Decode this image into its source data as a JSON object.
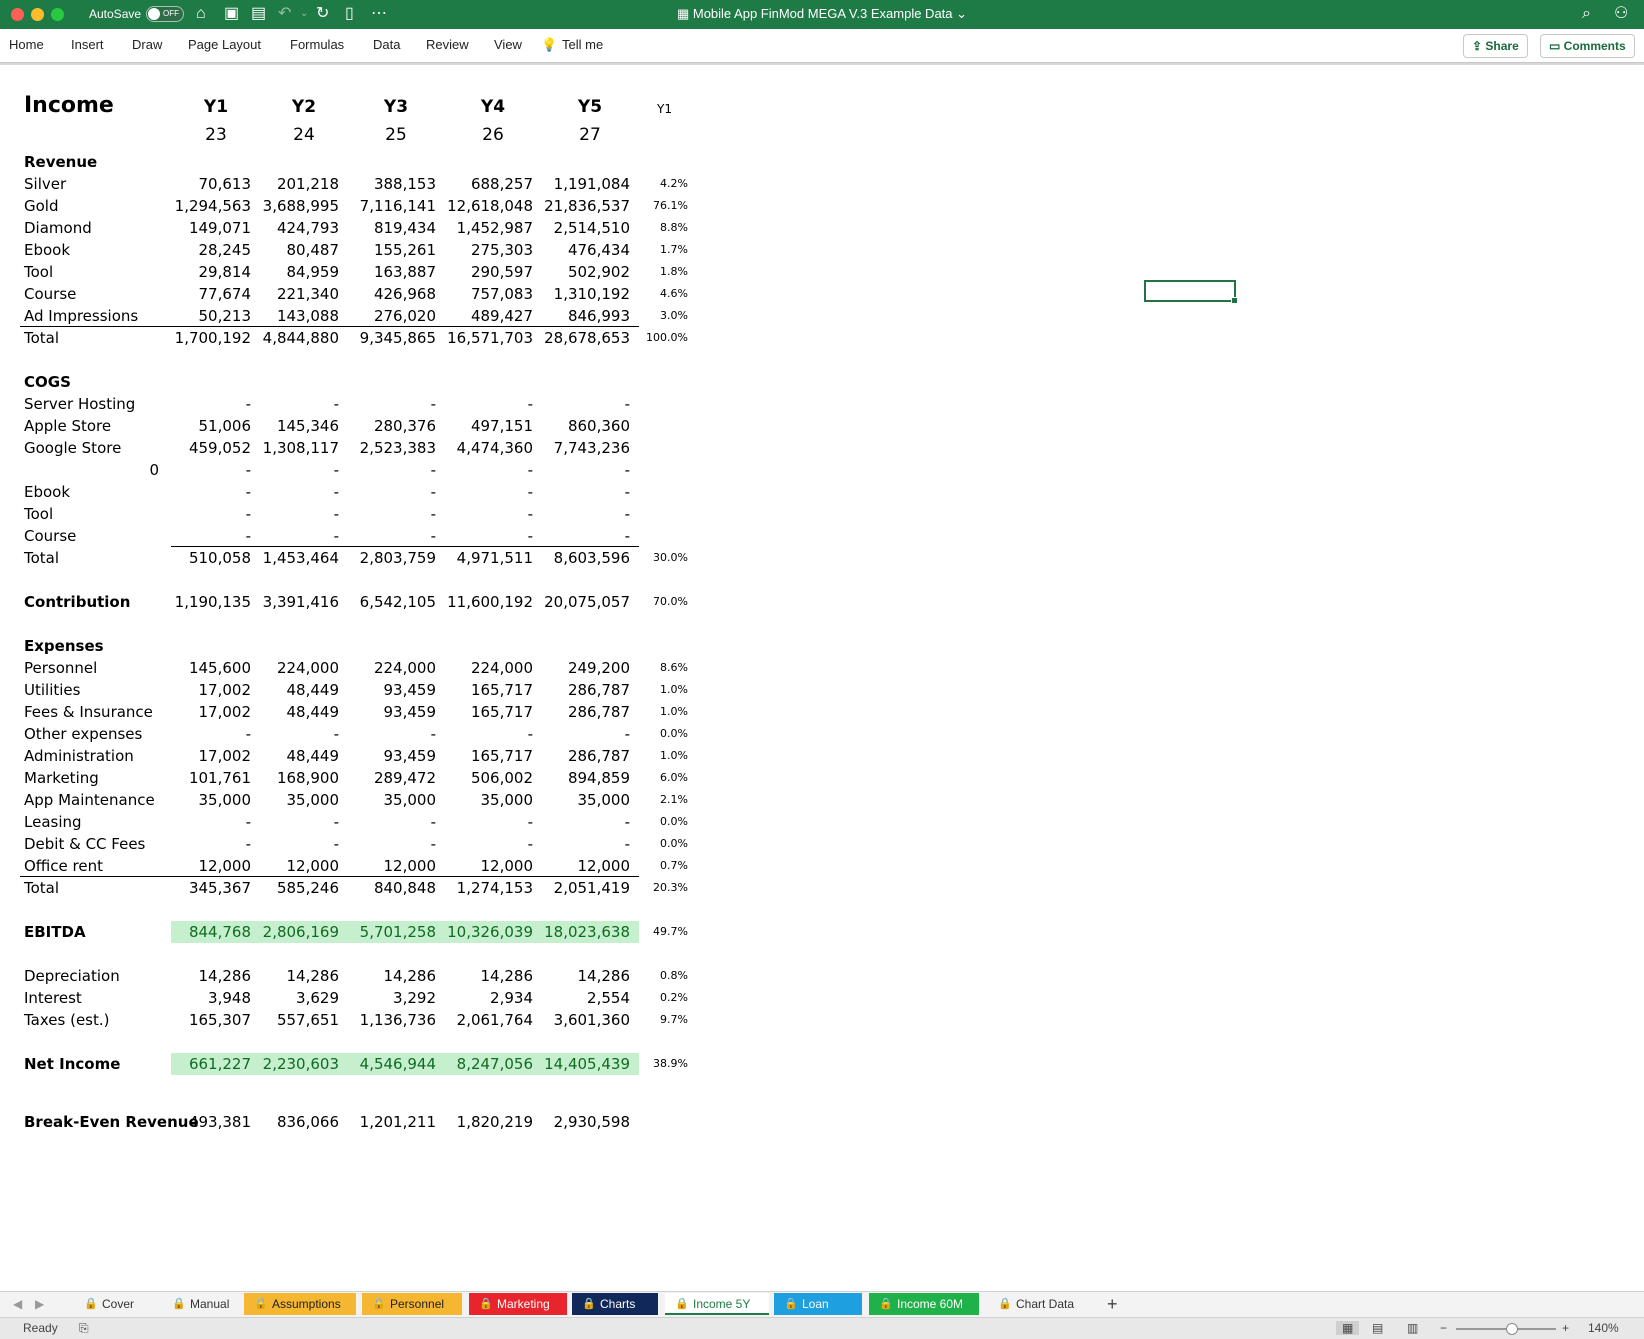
{
  "titlebar": {
    "autosave_label": "AutoSave",
    "autosave_state": "OFF",
    "title": "Mobile App FinMod MEGA V.3 Example Data",
    "icons": [
      "home-icon",
      "save-icon",
      "save-as-icon",
      "undo-icon",
      "redo-icon",
      "new-doc-icon",
      "more-icon",
      "search-icon",
      "account-icon"
    ]
  },
  "ribbon": {
    "tabs": [
      "Home",
      "Insert",
      "Draw",
      "Page Layout",
      "Formulas",
      "Data",
      "Review",
      "View",
      "Tell me"
    ],
    "share_label": "Share",
    "comments_label": "Comments"
  },
  "sheet": {
    "title": "Income",
    "years": [
      "Y1",
      "Y2",
      "Y3",
      "Y4",
      "Y5"
    ],
    "year_nums": [
      "23",
      "24",
      "25",
      "26",
      "27"
    ],
    "pct_header": "Y1",
    "revenue_header": "Revenue",
    "revenue": [
      {
        "label": "Silver",
        "v": [
          "70,613",
          "201,218",
          "388,153",
          "688,257",
          "1,191,084"
        ],
        "pct": "4.2%"
      },
      {
        "label": "Gold",
        "v": [
          "1,294,563",
          "3,688,995",
          "7,116,141",
          "12,618,048",
          "21,836,537"
        ],
        "pct": "76.1%"
      },
      {
        "label": "Diamond",
        "v": [
          "149,071",
          "424,793",
          "819,434",
          "1,452,987",
          "2,514,510"
        ],
        "pct": "8.8%"
      },
      {
        "label": "Ebook",
        "v": [
          "28,245",
          "80,487",
          "155,261",
          "275,303",
          "476,434"
        ],
        "pct": "1.7%"
      },
      {
        "label": "Tool",
        "v": [
          "29,814",
          "84,959",
          "163,887",
          "290,597",
          "502,902"
        ],
        "pct": "1.8%"
      },
      {
        "label": "Course",
        "v": [
          "77,674",
          "221,340",
          "426,968",
          "757,083",
          "1,310,192"
        ],
        "pct": "4.6%"
      },
      {
        "label": "Ad Impressions",
        "v": [
          "50,213",
          "143,088",
          "276,020",
          "489,427",
          "846,993"
        ],
        "pct": "3.0%"
      }
    ],
    "revenue_total": {
      "label": "Total",
      "v": [
        "1,700,192",
        "4,844,880",
        "9,345,865",
        "16,571,703",
        "28,678,653"
      ],
      "pct": "100.0%"
    },
    "cogs_header": "COGS",
    "cogs": [
      {
        "label": "Server Hosting",
        "v": [
          "-",
          "-",
          "-",
          "-",
          "-"
        ]
      },
      {
        "label": "Apple Store",
        "v": [
          "51,006",
          "145,346",
          "280,376",
          "497,151",
          "860,360"
        ]
      },
      {
        "label": "Google Store",
        "v": [
          "459,052",
          "1,308,117",
          "2,523,383",
          "4,474,360",
          "7,743,236"
        ]
      },
      {
        "label": "",
        "zero": "0",
        "v": [
          "-",
          "-",
          "-",
          "-",
          "-"
        ]
      },
      {
        "label": "Ebook",
        "v": [
          "-",
          "-",
          "-",
          "-",
          "-"
        ]
      },
      {
        "label": "Tool",
        "v": [
          "-",
          "-",
          "-",
          "-",
          "-"
        ]
      },
      {
        "label": "Course",
        "v": [
          "-",
          "-",
          "-",
          "-",
          "-"
        ]
      }
    ],
    "cogs_total": {
      "label": "Total",
      "v": [
        "510,058",
        "1,453,464",
        "2,803,759",
        "4,971,511",
        "8,603,596"
      ],
      "pct": "30.0%"
    },
    "contribution": {
      "label": "Contribution",
      "v": [
        "1,190,135",
        "3,391,416",
        "6,542,105",
        "11,600,192",
        "20,075,057"
      ],
      "pct": "70.0%"
    },
    "expenses_header": "Expenses",
    "expenses": [
      {
        "label": "Personnel",
        "v": [
          "145,600",
          "224,000",
          "224,000",
          "224,000",
          "249,200"
        ],
        "pct": "8.6%"
      },
      {
        "label": "Utilities",
        "v": [
          "17,002",
          "48,449",
          "93,459",
          "165,717",
          "286,787"
        ],
        "pct": "1.0%"
      },
      {
        "label": "Fees & Insurance",
        "v": [
          "17,002",
          "48,449",
          "93,459",
          "165,717",
          "286,787"
        ],
        "pct": "1.0%"
      },
      {
        "label": "Other expenses",
        "v": [
          "-",
          "-",
          "-",
          "-",
          "-"
        ],
        "pct": "0.0%"
      },
      {
        "label": "Administration",
        "v": [
          "17,002",
          "48,449",
          "93,459",
          "165,717",
          "286,787"
        ],
        "pct": "1.0%"
      },
      {
        "label": "Marketing",
        "v": [
          "101,761",
          "168,900",
          "289,472",
          "506,002",
          "894,859"
        ],
        "pct": "6.0%"
      },
      {
        "label": "App Maintenance",
        "v": [
          "35,000",
          "35,000",
          "35,000",
          "35,000",
          "35,000"
        ],
        "pct": "2.1%"
      },
      {
        "label": "Leasing",
        "v": [
          "-",
          "-",
          "-",
          "-",
          "-"
        ],
        "pct": "0.0%"
      },
      {
        "label": "Debit & CC Fees",
        "v": [
          "-",
          "-",
          "-",
          "-",
          "-"
        ],
        "pct": "0.0%"
      },
      {
        "label": "Office rent",
        "v": [
          "12,000",
          "12,000",
          "12,000",
          "12,000",
          "12,000"
        ],
        "pct": "0.7%"
      }
    ],
    "expenses_total": {
      "label": "Total",
      "v": [
        "345,367",
        "585,246",
        "840,848",
        "1,274,153",
        "2,051,419"
      ],
      "pct": "20.3%"
    },
    "ebitda": {
      "label": "EBITDA",
      "v": [
        "844,768",
        "2,806,169",
        "5,701,258",
        "10,326,039",
        "18,023,638"
      ],
      "pct": "49.7%"
    },
    "below": [
      {
        "label": "Depreciation",
        "v": [
          "14,286",
          "14,286",
          "14,286",
          "14,286",
          "14,286"
        ],
        "pct": "0.8%"
      },
      {
        "label": "Interest",
        "v": [
          "3,948",
          "3,629",
          "3,292",
          "2,934",
          "2,554"
        ],
        "pct": "0.2%"
      },
      {
        "label": "Taxes (est.)",
        "v": [
          "165,307",
          "557,651",
          "1,136,736",
          "2,061,764",
          "3,601,360"
        ],
        "pct": "9.7%"
      }
    ],
    "net_income": {
      "label": "Net Income",
      "v": [
        "661,227",
        "2,230,603",
        "4,546,944",
        "8,247,056",
        "14,405,439"
      ],
      "pct": "38.9%"
    },
    "break_even": {
      "label": "Break-Even Revenue",
      "v": [
        "493,381",
        "836,066",
        "1,201,211",
        "1,820,219",
        "2,930,598"
      ]
    }
  },
  "sheet_tabs": [
    {
      "label": "Cover",
      "color": ""
    },
    {
      "label": "Manual",
      "color": ""
    },
    {
      "label": "Assumptions",
      "color": "#f5b731"
    },
    {
      "label": "Personnel",
      "color": "#f5b731"
    },
    {
      "label": "Marketing",
      "color": "#e8252c"
    },
    {
      "label": "Charts",
      "color": "#10285a"
    },
    {
      "label": "Income 5Y",
      "color": "",
      "active": true
    },
    {
      "label": "Loan",
      "color": "#1ea0e0"
    },
    {
      "label": "Income 60M",
      "color": "#1fb14a"
    },
    {
      "label": "Chart Data",
      "color": ""
    }
  ],
  "status": {
    "ready": "Ready",
    "zoom": "140%"
  }
}
